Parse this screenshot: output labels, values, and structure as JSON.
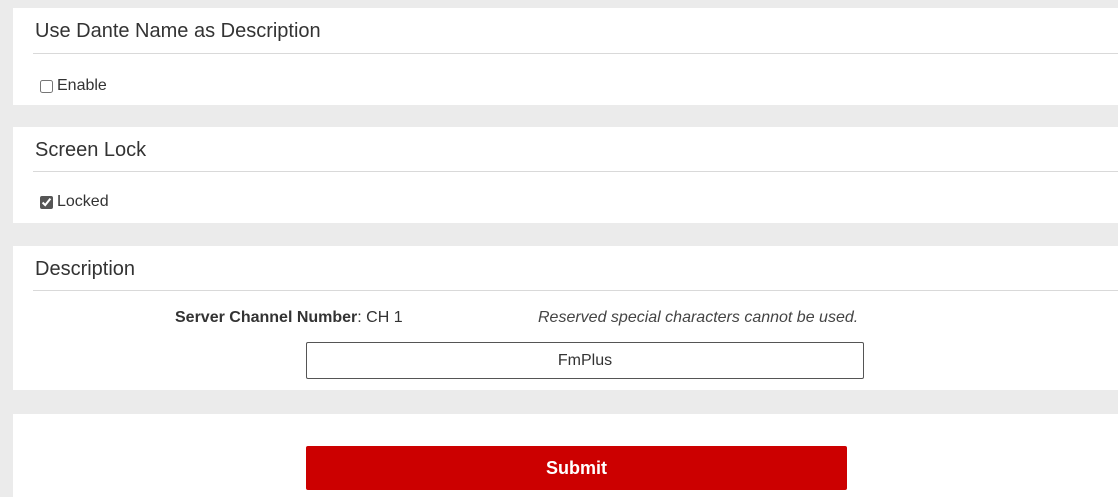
{
  "dante_section": {
    "title": "Use Dante Name as Description",
    "enable_label": "Enable",
    "enable_checked": false
  },
  "screen_lock_section": {
    "title": "Screen Lock",
    "locked_label": "Locked",
    "locked_checked": true
  },
  "description_section": {
    "title": "Description",
    "server_channel_label": "Server Channel Number",
    "server_channel_value": ": CH 1",
    "hint": "Reserved special characters cannot be used.",
    "description_value": "FmPlus"
  },
  "submit": {
    "label": "Submit"
  },
  "colors": {
    "page_background": "#ebebeb",
    "panel_background": "#ffffff",
    "submit_background": "#cc0000",
    "submit_text": "#ffffff"
  }
}
